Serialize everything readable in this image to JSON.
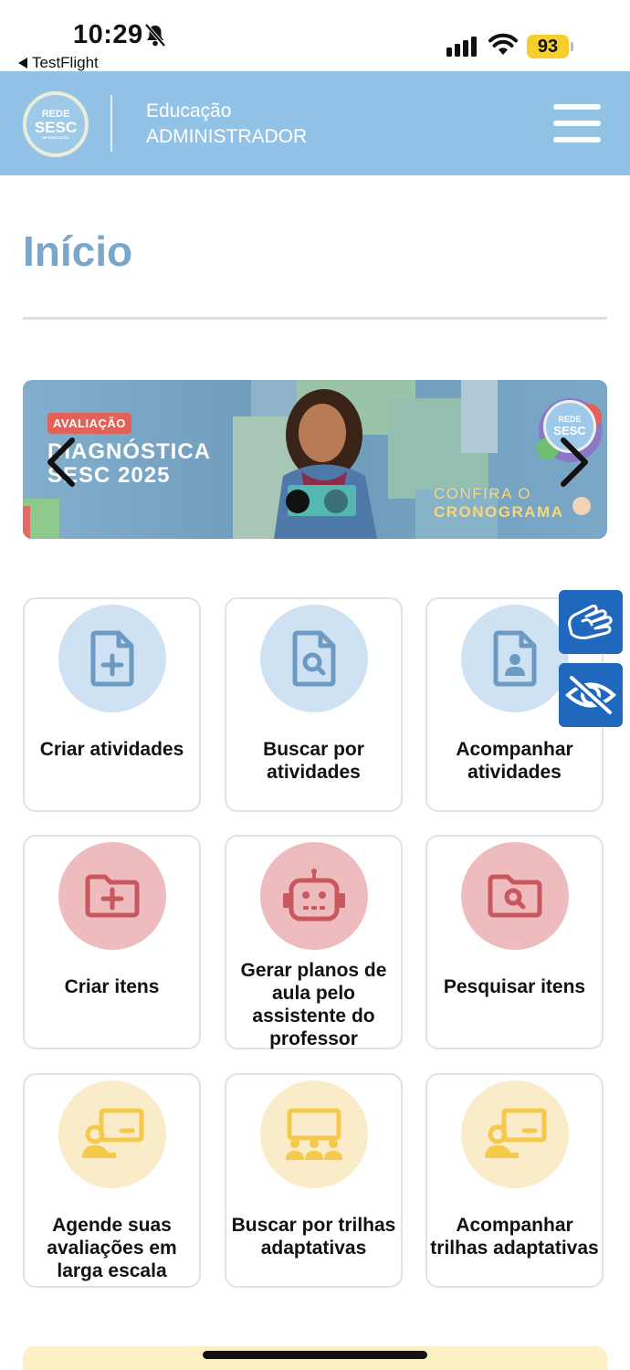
{
  "status_bar": {
    "time": "10:29",
    "back_app": "TestFlight",
    "battery": "93",
    "icons": [
      "bell-slash-icon",
      "signal-icon",
      "wifi-icon",
      "battery-icon"
    ]
  },
  "header": {
    "logo": {
      "line1": "REDE",
      "line2": "SESC",
      "line3": "DE EDUCAÇÃO"
    },
    "subtitle": "Educação",
    "role": "ADMINISTRADOR",
    "menu_icon": "hamburger-menu-icon"
  },
  "page": {
    "title": "Início"
  },
  "banner": {
    "badge": "AVALIAÇÃO",
    "title_line1": "DIAGNÓSTICA",
    "title_line2": "SESC 2025",
    "cta_line1": "CONFIRA O",
    "cta_line2": "CRONOGRAMA",
    "logo_line1": "REDE",
    "logo_line2": "SESC",
    "active_slide": 1,
    "slide_count": 2
  },
  "cards": [
    {
      "label": "Criar atividades",
      "icon": "file-plus-icon",
      "color": "#cfe2f3"
    },
    {
      "label": "Buscar por atividades",
      "icon": "file-search-icon",
      "color": "#cfe2f3"
    },
    {
      "label": "Acompanhar atividades",
      "icon": "file-user-icon",
      "color": "#cfe2f3"
    },
    {
      "label": "Criar itens",
      "icon": "folder-plus-icon",
      "color": "#eebcbe"
    },
    {
      "label": "Gerar planos de aula pelo assistente do professor",
      "icon": "robot-icon",
      "color": "#eebcbe"
    },
    {
      "label": "Pesquisar itens",
      "icon": "folder-search-icon",
      "color": "#eebcbe"
    },
    {
      "label": "Agende suas avaliações em larga escala",
      "icon": "teacher-board-icon",
      "color": "#faecc9"
    },
    {
      "label": "Buscar por trilhas adaptativas",
      "icon": "classroom-icon",
      "color": "#faecc9"
    },
    {
      "label": "Acompanhar trilhas adaptativas",
      "icon": "teacher-board-icon",
      "color": "#faecc9"
    }
  ],
  "accessibility": {
    "sign_language_icon": "sign-language-icon",
    "low_vision_icon": "eye-slash-icon"
  },
  "colors": {
    "header": "#92c3e6",
    "title": "#7aa6cc",
    "accent_blue": "#1f68bd",
    "icon_blue": "#6d9ac2",
    "icon_red": "#c9585e",
    "icon_yellow": "#f5c94c"
  }
}
